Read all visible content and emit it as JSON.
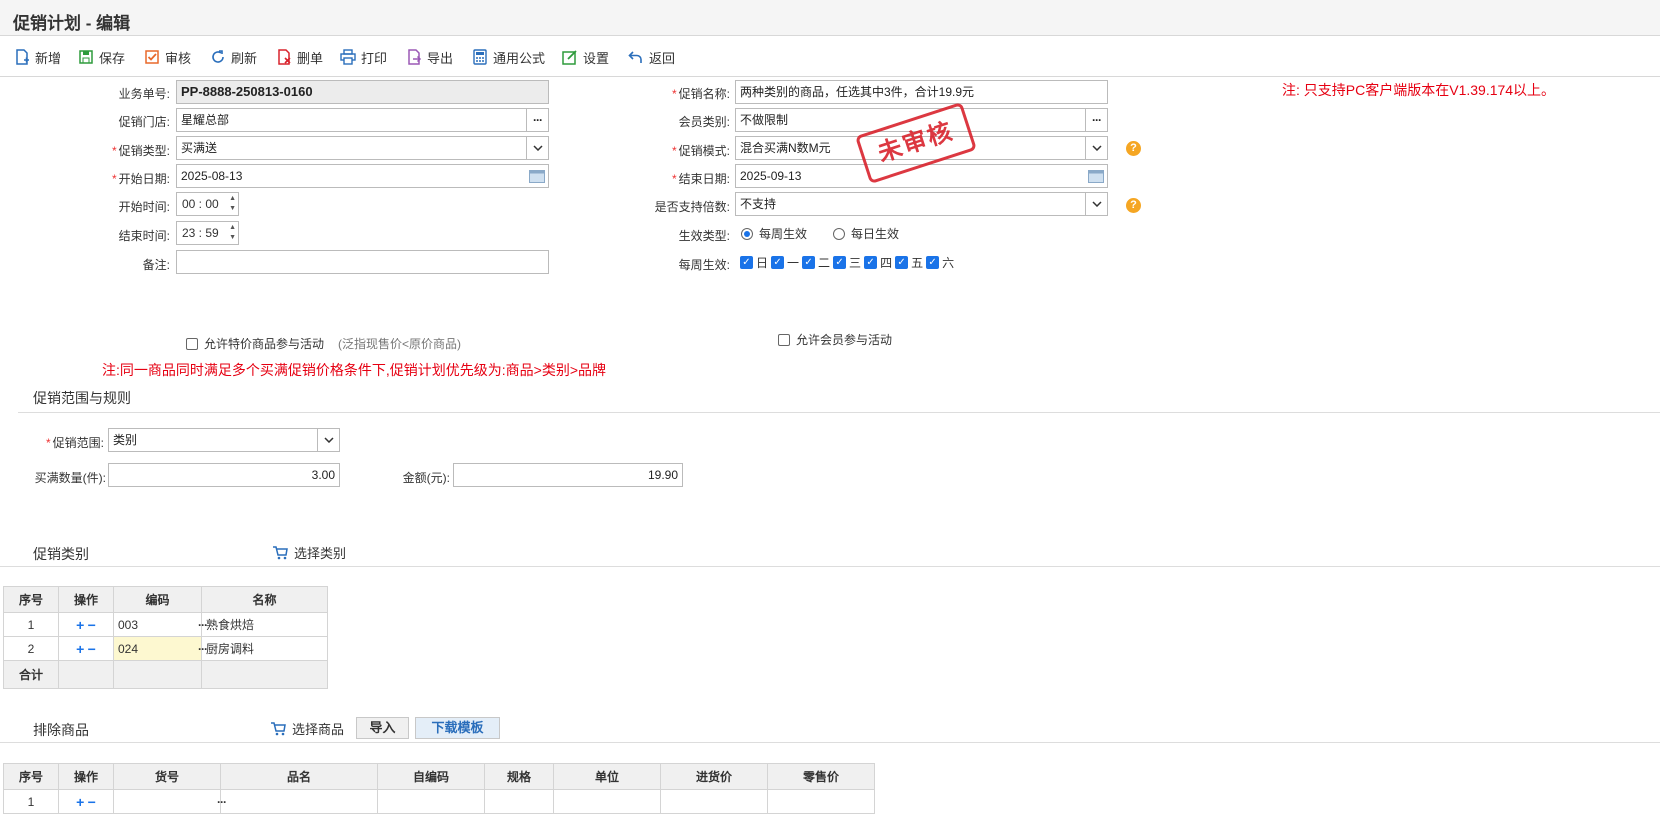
{
  "title": "促销计划 - 编辑",
  "toolbar": [
    {
      "label": "新增",
      "icon": "new-doc-icon"
    },
    {
      "label": "保存",
      "icon": "save-icon"
    },
    {
      "label": "审核",
      "icon": "audit-icon"
    },
    {
      "label": "刷新",
      "icon": "refresh-icon"
    },
    {
      "label": "删单",
      "icon": "delete-doc-icon"
    },
    {
      "label": "打印",
      "icon": "print-icon"
    },
    {
      "label": "导出",
      "icon": "export-icon"
    },
    {
      "label": "通用公式",
      "icon": "formula-icon"
    },
    {
      "label": "设置",
      "icon": "settings-icon"
    },
    {
      "label": "返回",
      "icon": "back-icon"
    }
  ],
  "notice_top": "注: 只支持PC客户端版本在V1.39.174以上。",
  "stamp": "未审核",
  "form": {
    "doc_no_label": "业务单号:",
    "doc_no": "PP-8888-250813-0160",
    "store_label": "促销门店:",
    "store": "星耀总部",
    "promo_type_label": "促销类型:",
    "promo_type": "买满送",
    "start_date_label": "开始日期:",
    "start_date": "2025-08-13",
    "start_time_label": "开始时间:",
    "start_time": "00 : 00",
    "end_time_label": "结束时间:",
    "end_time": "23 : 59",
    "remark_label": "备注:",
    "remark": "",
    "promo_name_label": "促销名称:",
    "promo_name": "两种类别的商品，任选其中3件，合计19.9元",
    "member_type_label": "会员类别:",
    "member_type": "不做限制",
    "promo_mode_label": "促销模式:",
    "promo_mode": "混合买满N数M元",
    "end_date_label": "结束日期:",
    "end_date": "2025-09-13",
    "multiple_label": "是否支持倍数:",
    "multiple": "不支持",
    "effect_type_label": "生效类型:",
    "effect_weekly": "每周生效",
    "effect_daily": "每日生效",
    "weekly_label": "每周生效:",
    "weekdays": [
      "日",
      "一",
      "二",
      "三",
      "四",
      "五",
      "六"
    ],
    "allow_special_label": "允许特价商品参与活动",
    "allow_special_hint": "(泛指现售价<原价商品)",
    "allow_member_label": "允许会员参与活动"
  },
  "notice_priority": "注:同一商品同时满足多个买满促销价格条件下,促销计划优先级为:商品>类别>品牌",
  "scope": {
    "section_title": "促销范围与规则",
    "scope_label": "促销范围:",
    "scope_value": "类别",
    "qty_label": "买满数量(件):",
    "qty_value": "3.00",
    "amount_label": "金额(元):",
    "amount_value": "19.90"
  },
  "category": {
    "section_title": "促销类别",
    "select_label": "选择类别",
    "headers": [
      "序号",
      "操作",
      "编码",
      "名称"
    ],
    "rows": [
      {
        "no": "1",
        "code": "003",
        "name": "熟食烘焙"
      },
      {
        "no": "2",
        "code": "024",
        "name": "厨房调料"
      }
    ],
    "total_label": "合计"
  },
  "exclude": {
    "section_title": "排除商品",
    "select_label": "选择商品",
    "import_label": "导入",
    "download_label": "下载模板",
    "headers": [
      "序号",
      "操作",
      "货号",
      "品名",
      "自编码",
      "规格",
      "单位",
      "进货价",
      "零售价"
    ],
    "rows": [
      {
        "no": "1"
      }
    ]
  },
  "colors": {
    "accent": "#1a73e8",
    "warning": "#e60012",
    "stamp": "#d9232d"
  }
}
